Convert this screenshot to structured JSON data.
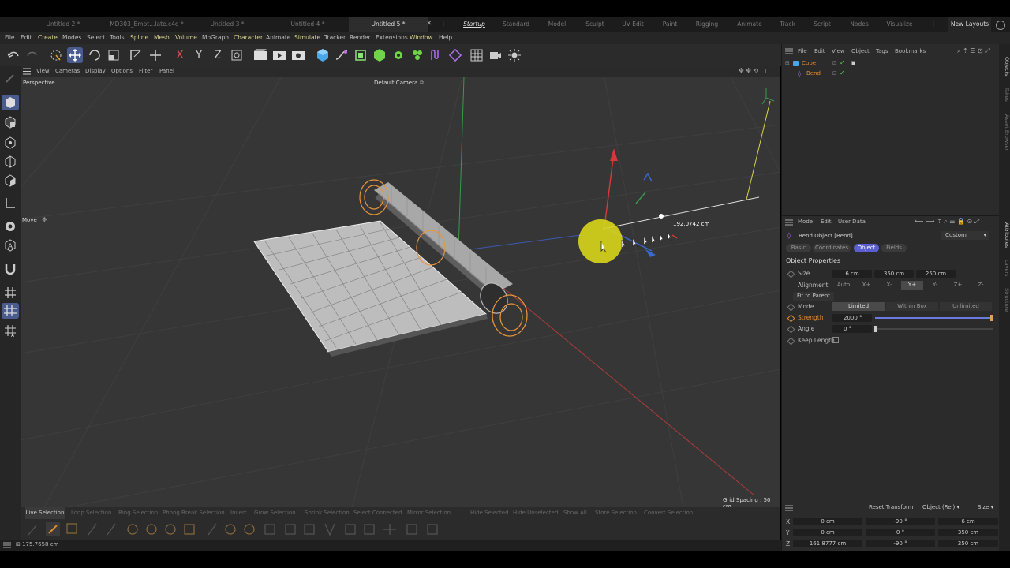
{
  "doc_tabs": [
    "Untitled 2 *",
    "MD303_Empt...late.c4d *",
    "Untitled 3 *",
    "Untitled 4 *",
    "Untitled 5 *"
  ],
  "layout_tabs": [
    "Startup",
    "Standard",
    "Model",
    "Sculpt",
    "UV Edit",
    "Paint",
    "Rigging",
    "Animate",
    "Track",
    "Script",
    "Nodes",
    "Visualize"
  ],
  "new_layouts": "New Layouts",
  "menu": [
    "File",
    "Edit",
    "Create",
    "Modes",
    "Select",
    "Tools",
    "Spline",
    "Mesh",
    "Volume",
    "MoGraph",
    "Character",
    "Animate",
    "Simulate",
    "Tracker",
    "Render",
    "Extensions",
    "Window",
    "Help"
  ],
  "viewport": {
    "menu": [
      "View",
      "Cameras",
      "Display",
      "Options",
      "Filter",
      "Panel"
    ],
    "perspective": "Perspective",
    "camera": "Default Camera",
    "tool_label": "Move",
    "distance_readout": "192.0742 cm",
    "grid_spacing": "Grid Spacing : 50 cm"
  },
  "objects_panel": {
    "menu": [
      "File",
      "Edit",
      "View",
      "Object",
      "Tags",
      "Bookmarks"
    ],
    "items": [
      {
        "name": "Cube",
        "color": "#e08a2e"
      },
      {
        "name": "Bend",
        "color": "#e08a2e"
      }
    ]
  },
  "attributes": {
    "menu": [
      "Mode",
      "Edit",
      "User Data"
    ],
    "object_title": "Bend Object [Bend]",
    "preset": "Custom",
    "tabs": [
      "Basic",
      "Coordinates",
      "Object",
      "Fields"
    ],
    "section": "Object Properties",
    "size_label": "Size",
    "size_values": [
      "6 cm",
      "350 cm",
      "250 cm"
    ],
    "alignment_label": "Alignment",
    "alignment_options": [
      "Auto",
      "X+",
      "X-",
      "Y+",
      "Y-",
      "Z+",
      "Z-"
    ],
    "fit_to_parent": "Fit to Parent",
    "mode_label": "Mode",
    "mode_options": [
      "Limited",
      "Within Box",
      "Unlimited"
    ],
    "strength_label": "Strength",
    "strength_value": "2000 °",
    "angle_label": "Angle",
    "angle_value": "0 °",
    "keep_length_label": "Keep Length"
  },
  "coordinates": {
    "reset_transform": "Reset Transform",
    "object_rel": "Object (Rel)",
    "size": "Size",
    "rows": [
      {
        "axis": "X",
        "pos": "0 cm",
        "rot": "-90 °",
        "size": "6 cm"
      },
      {
        "axis": "Y",
        "pos": "0 cm",
        "rot": "0 °",
        "size": "350 cm"
      },
      {
        "axis": "Z",
        "pos": "161.8777 cm",
        "rot": "-90 °",
        "size": "250 cm"
      }
    ]
  },
  "side_tabs": [
    "Objects",
    "Takes",
    "Asset Browser",
    "Attributes",
    "Layers",
    "Structure"
  ],
  "selection_bar": [
    "Live Selection",
    "Loop Selection",
    "Ring Selection",
    "Phong Break Selection",
    "Invert",
    "Grow Selection",
    "Shrink Selection",
    "Select Connected",
    "Mirror Selection...",
    "Hide Selected",
    "Hide Unselected",
    "Show All",
    "Store Selection",
    "Convert Selection"
  ],
  "status": "175.7658 cm"
}
